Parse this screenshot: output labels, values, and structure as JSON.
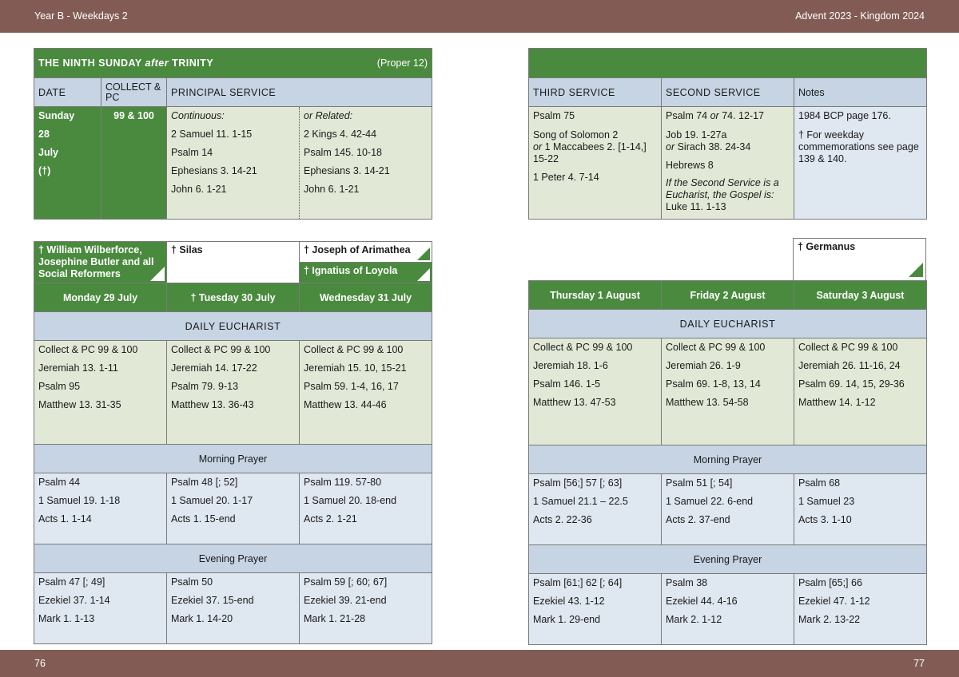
{
  "header": {
    "left": "Year B - Weekdays 2",
    "right": "Advent  2023 - Kingdom 2024"
  },
  "footer": {
    "left_page": "76",
    "right_page": "77"
  },
  "sunday": {
    "title_prefix": "THE NINTH SUNDAY ",
    "title_italic": "after",
    "title_suffix": " TRINITY",
    "proper": "(Proper 12)",
    "col_date": "DATE",
    "col_collect": "COLLECT & PC",
    "col_principal": "PRINCIPAL SERVICE",
    "date_lines": [
      "Sunday",
      "28",
      "July",
      "(†)"
    ],
    "collect": "99 & 100",
    "continuous_label": "Continuous:",
    "continuous": [
      "2 Samuel 11. 1-15",
      "Psalm 14",
      "Ephesians 3. 14-21",
      "John 6. 1-21"
    ],
    "related_label": "or Related:",
    "related": [
      "2 Kings 4. 42-44",
      "Psalm 145. 10-18",
      "Ephesians 3. 14-21",
      "John 6. 1-21"
    ]
  },
  "other_services": {
    "col_third": "THIRD SERVICE",
    "col_second": "SECOND SERVICE",
    "col_notes": "Notes",
    "third": {
      "l1": "Psalm 75",
      "l2": "Song of Solomon 2",
      "l3_or": "or",
      "l3": " 1 Maccabees 2. [1-14,]",
      "l4": "15-22",
      "l5": "1 Peter 4. 7-14"
    },
    "second": {
      "l1a": "Psalm 74 ",
      "l1_or": "or",
      "l1b": "  74. 12-17",
      "l2": "Job 19. 1-27a",
      "l3_or": "or",
      "l3": " Sirach 38. 24-34",
      "l4": "Hebrews 8",
      "note": "If the Second Service is a Eucharist, the Gospel is:",
      "gospel": "Luke 11. 1-13"
    },
    "notes": {
      "l1": "1984 BCP page 176.",
      "l2": "† For weekday commemorations see page 139 & 140."
    }
  },
  "left_week": {
    "commemorations": {
      "mon": "† William Wilberforce, Josephine Butler and all Social Reformers",
      "tue": "† Silas",
      "wed1": "† Joseph of Arimathea",
      "wed2": "† Ignatius of Loyola"
    },
    "days": [
      "Monday 29 July",
      "† Tuesday 30 July",
      "Wednesday 31 July"
    ],
    "daily_eucharist_label": "DAILY EUCHARIST",
    "eucharist": [
      [
        "Collect & PC 99 & 100",
        "Jeremiah 13. 1-11",
        "Psalm 95",
        "Matthew 13. 31-35"
      ],
      [
        "Collect & PC 99 & 100",
        "Jeremiah 14. 17-22",
        "Psalm 79. 9-13",
        "Matthew 13. 36-43"
      ],
      [
        "Collect & PC 99 & 100",
        "Jeremiah 15. 10, 15-21",
        "Psalm 59. 1-4, 16, 17",
        "Matthew 13. 44-46"
      ]
    ],
    "morning_label": "Morning Prayer",
    "morning": [
      [
        "Psalm 44",
        "1 Samuel 19. 1-18",
        "Acts 1. 1-14"
      ],
      [
        "Psalm 48 [; 52]",
        "1 Samuel 20. 1-17",
        "Acts 1. 15-end"
      ],
      [
        "Psalm 119. 57-80",
        "1 Samuel 20. 18-end",
        "Acts 2. 1-21"
      ]
    ],
    "evening_label": "Evening Prayer",
    "evening": [
      [
        "Psalm 47 [; 49]",
        "Ezekiel 37. 1-14",
        "Mark 1. 1-13"
      ],
      [
        "Psalm 50",
        "Ezekiel 37. 15-end",
        "Mark 1. 14-20"
      ],
      [
        "Psalm 59 [; 60; 67]",
        "Ezekiel 39. 21-end",
        "Mark 1. 21-28"
      ]
    ]
  },
  "right_week": {
    "commemorations": {
      "sat": "† Germanus"
    },
    "days": [
      "Thursday 1 August",
      "Friday 2 August",
      "Saturday 3 August"
    ],
    "daily_eucharist_label": "DAILY EUCHARIST",
    "eucharist": [
      [
        "Collect & PC 99 & 100",
        "Jeremiah 18. 1-6",
        "Psalm 146. 1-5",
        "Matthew 13. 47-53"
      ],
      [
        "Collect & PC 99 & 100",
        "Jeremiah 26. 1-9",
        "Psalm 69. 1-8, 13, 14",
        "Matthew 13. 54-58"
      ],
      [
        "Collect & PC 99 & 100",
        "Jeremiah 26. 11-16, 24",
        "Psalm 69. 14, 15, 29-36",
        "Matthew 14. 1-12"
      ]
    ],
    "morning_label": "Morning Prayer",
    "morning": [
      [
        "Psalm [56;] 57 [; 63]",
        "1 Samuel 21.1 – 22.5",
        "Acts 2. 22-36"
      ],
      [
        "Psalm 51 [; 54]",
        "1 Samuel 22. 6-end",
        "Acts 2. 37-end"
      ],
      [
        "Psalm 68",
        "1 Samuel 23",
        "Acts 3. 1-10"
      ]
    ],
    "evening_label": "Evening Prayer",
    "evening": [
      [
        "Psalm [61;] 62 [; 64]",
        "Ezekiel 43. 1-12",
        "Mark 1. 29-end"
      ],
      [
        "Psalm 38",
        "Ezekiel 44. 4-16",
        "Mark 2. 1-12"
      ],
      [
        "Psalm [65;] 66",
        "Ezekiel 47. 1-12",
        "Mark 2. 13-22"
      ]
    ]
  }
}
